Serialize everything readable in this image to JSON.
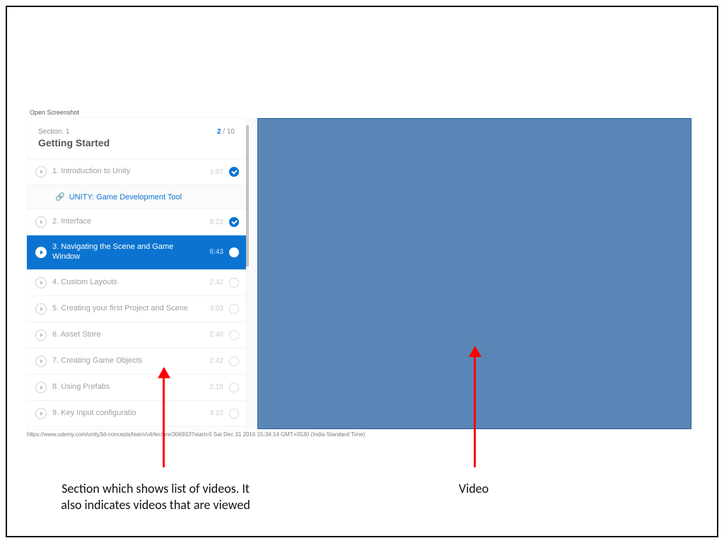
{
  "shot_title": "Open Screenshot",
  "section": {
    "label": "Section: 1",
    "title": "Getting Started",
    "progress_current": "2",
    "progress_total": "/ 10"
  },
  "items": [
    {
      "num": "1.",
      "label": "Introduction to Unity",
      "dur": "1:07",
      "viewed": true
    },
    {
      "num": "2.",
      "label": "Interface",
      "dur": "8:23",
      "viewed": true
    },
    {
      "num": "3.",
      "label": "Navigating the Scene and Game Window",
      "dur": "6:43",
      "current": true
    },
    {
      "num": "4.",
      "label": "Custom Layouts",
      "dur": "2:42"
    },
    {
      "num": "5.",
      "label": "Creating your first Project and Scene",
      "dur": "4:03"
    },
    {
      "num": "6.",
      "label": "Asset Store",
      "dur": "2:48"
    },
    {
      "num": "7.",
      "label": "Creating Game Objects",
      "dur": "2:42"
    },
    {
      "num": "8.",
      "label": "Using Prefabs",
      "dur": "2:15"
    },
    {
      "num": "9.",
      "label": "Key Input configuratio",
      "dur": "4:12"
    }
  ],
  "sublink": "UNITY: Game Development Tool",
  "footer_url": "https://www.udemy.com/unity3d-concepts/learn/v4/lecture/306933?start=0 Sat Dec 31 2016 15:34:14 GMT+0530 (India Standard Time)",
  "captions": {
    "left": "Section which shows list of videos. It also indicates videos that are viewed",
    "right": "Video"
  }
}
